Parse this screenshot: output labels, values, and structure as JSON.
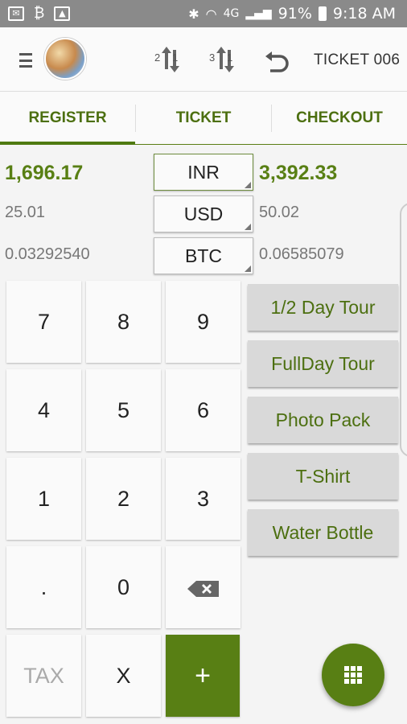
{
  "status_bar": {
    "battery": "91%",
    "time": "9:18 AM",
    "network": "4G"
  },
  "app_bar": {
    "sort_a": {
      "first": "2",
      "second": "1"
    },
    "sort_b": {
      "first": "3",
      "second": "1"
    },
    "ticket_title": "TICKET 006"
  },
  "tabs": [
    {
      "label": "REGISTER",
      "active": true
    },
    {
      "label": "TICKET",
      "active": false
    },
    {
      "label": "CHECKOUT",
      "active": false
    }
  ],
  "currencies": [
    {
      "code": "INR",
      "left_amount": "1,696.17",
      "right_amount": "3,392.33"
    },
    {
      "code": "USD",
      "left_amount": "25.01",
      "right_amount": "50.02"
    },
    {
      "code": "BTC",
      "left_amount": "0.03292540",
      "right_amount": "0.06585079"
    }
  ],
  "keypad": {
    "k7": "7",
    "k8": "8",
    "k9": "9",
    "k4": "4",
    "k5": "5",
    "k6": "6",
    "k1": "1",
    "k2": "2",
    "k3": "3",
    "kdot": ".",
    "k0": "0",
    "tax": "TAX",
    "x": "X",
    "plus": "+"
  },
  "products": [
    "1/2 Day Tour",
    "FullDay Tour",
    "Photo Pack",
    "T-Shirt",
    "Water Bottle"
  ],
  "colors": {
    "accent": "#587f14",
    "status_bar": "#8a8a8a",
    "product_button": "#d9d9d9"
  },
  "icons": {
    "menu": "menu-icon",
    "sort": "sort-arrows-icon",
    "undo": "undo-icon",
    "backspace": "backspace-icon",
    "fab": "grid-icon"
  }
}
